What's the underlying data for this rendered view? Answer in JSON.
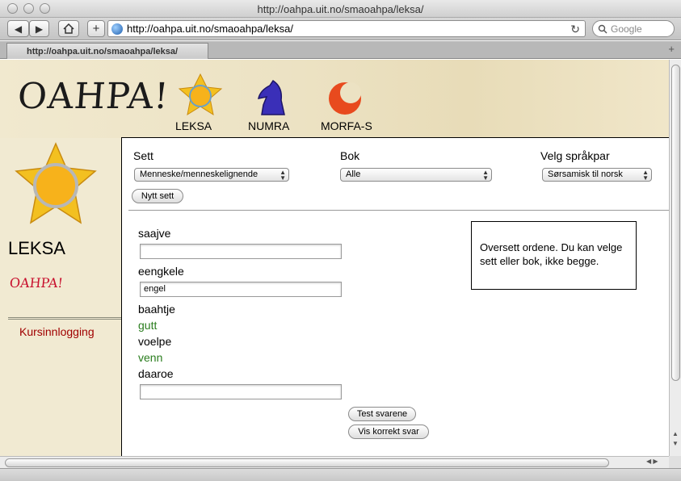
{
  "window": {
    "title": "http://oahpa.uit.no/smaoahpa/leksa/"
  },
  "toolbar": {
    "url": "http://oahpa.uit.no/smaoahpa/leksa/",
    "search_placeholder": "Google",
    "back": "◀",
    "forward": "▶",
    "add": "+",
    "reload": "↻"
  },
  "tab": {
    "label": "http://oahpa.uit.no/smaoahpa/leksa/"
  },
  "header": {
    "logo": "OAHPA!",
    "nav": [
      {
        "label": "LEKSA"
      },
      {
        "label": "NUMRA"
      },
      {
        "label": "MORFA-S"
      }
    ]
  },
  "sidebar": {
    "title": "LEKSA",
    "brand": "OAHPA!",
    "link": "Kursinnlogging"
  },
  "form": {
    "set_label": "Sett",
    "set_value": "Menneske/menneskelignende",
    "book_label": "Bok",
    "book_value": "Alle",
    "pair_label": "Velg språkpar",
    "pair_value": "Sørsamisk til norsk",
    "new_set": "Nytt sett"
  },
  "exercise": [
    {
      "word": "saajve",
      "answer": "",
      "type": "input"
    },
    {
      "word": "eengkele",
      "answer": "engel",
      "type": "input"
    },
    {
      "word": "baahtje",
      "answer": "gutt",
      "type": "correct"
    },
    {
      "word": "voelpe",
      "answer": "venn",
      "type": "correct"
    },
    {
      "word": "daaroe",
      "answer": "",
      "type": "input"
    }
  ],
  "info": "Oversett ordene. Du kan velge sett eller bok, ikke begge.",
  "buttons": {
    "test": "Test svarene",
    "show": "Vis korrekt svar"
  },
  "colors": {
    "brand_red": "#c8102e",
    "correct_green": "#2a7d1e",
    "link_red": "#a00000"
  }
}
